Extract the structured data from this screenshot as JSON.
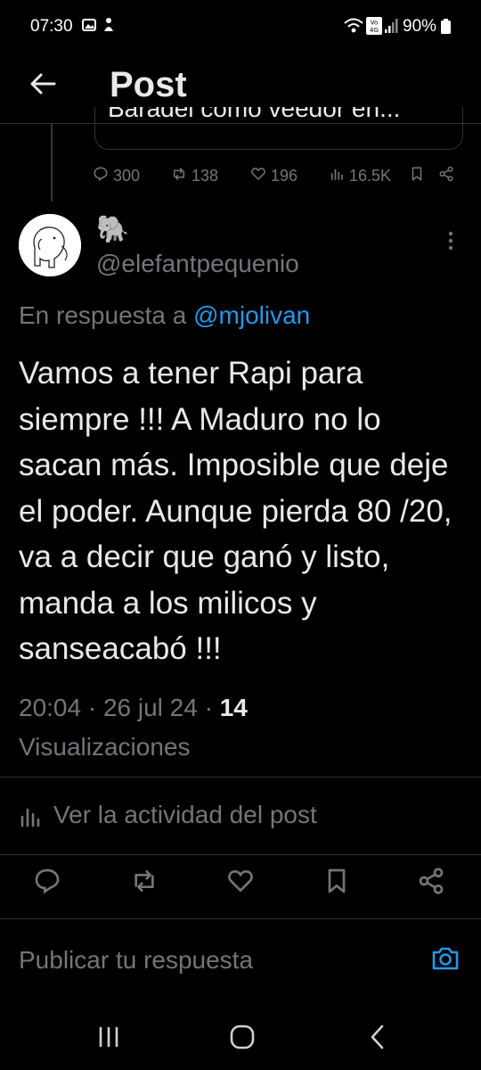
{
  "status_bar": {
    "time": "07:30",
    "battery": "90%"
  },
  "header": {
    "back_icon": "arrow-left-icon",
    "title": "Post"
  },
  "parent_post": {
    "quote_text": "Baradel como veedor en...",
    "stats": {
      "replies": "300",
      "reposts": "138",
      "likes": "196",
      "views": "16.5K"
    }
  },
  "post": {
    "display_name": "🐘",
    "handle": "@elefantpequenio",
    "reply_prefix": "En respuesta a",
    "reply_to": "@mjolivan",
    "text": "Vamos a tener Rapi para siempre !!! A Maduro no lo sacan más.  Imposible que deje el poder. Aunque pierda 80 /20, va a decir que ganó y listo, manda a los milicos y sanseacabó !!!",
    "time": "20:04",
    "date": "26 jul 24",
    "views_count": "14",
    "views_label": "Visualizaciones"
  },
  "activity": {
    "label": "Ver la actividad del post"
  },
  "compose": {
    "placeholder": "Publicar tu respuesta"
  },
  "colors": {
    "background": "#000000",
    "text": "#e7e9ea",
    "muted": "#71767b",
    "accent": "#1d9bf0",
    "divider": "#2f3336"
  }
}
